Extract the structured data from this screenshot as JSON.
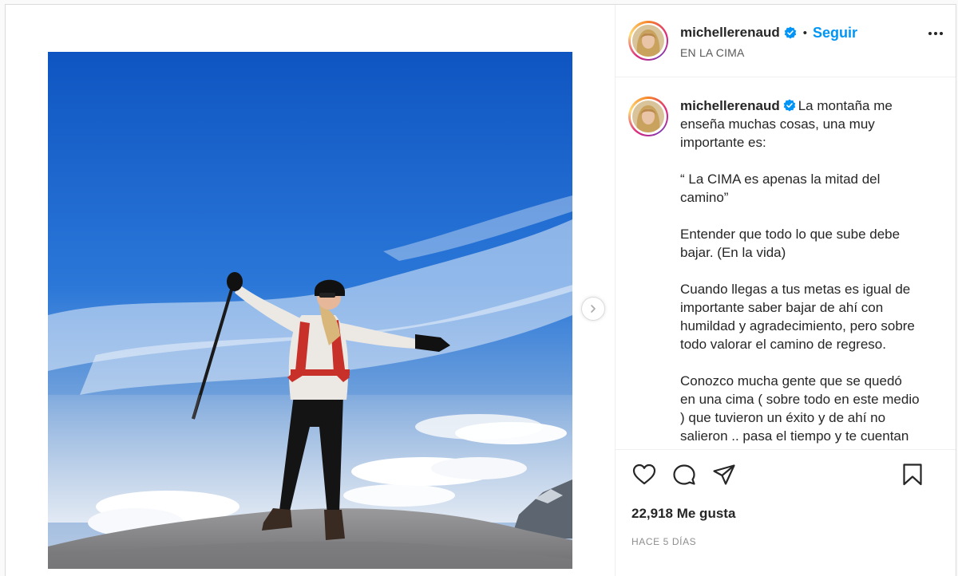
{
  "post": {
    "username": "michellerenaud",
    "follow_label": "Seguir",
    "dot": "•",
    "location": "EN LA CIMA"
  },
  "caption": {
    "username": "michellerenaud",
    "paragraphs": [
      "La montaña me enseña muchas cosas, una muy importante es:",
      "“ La CIMA es apenas la mitad del camino”",
      "Entender que todo lo que sube debe bajar. (En la vida)",
      "Cuando llegas a tus metas es igual de importante saber bajar de ahí con humildad y agradecimiento, pero sobre todo valorar el camino de regreso.",
      "Conozco mucha gente que se quedó en una cima ( sobre todo en este medio ) que tuvieron un éxito y de ahí no salieron .. pasa el tiempo y te cuentan lo"
    ]
  },
  "stats": {
    "likes": "22,918 Me gusta",
    "time": "HACE 5 DÍAS"
  },
  "icons": {
    "verified": "verified-badge-icon",
    "more": "more-options-icon",
    "like": "heart-icon",
    "comment": "comment-icon",
    "share": "share-icon",
    "save": "bookmark-icon",
    "next": "chevron-right-icon"
  },
  "colors": {
    "accent": "#0095f6",
    "text": "#262626",
    "muted": "#8e8e8e",
    "border": "#dbdbdb"
  }
}
